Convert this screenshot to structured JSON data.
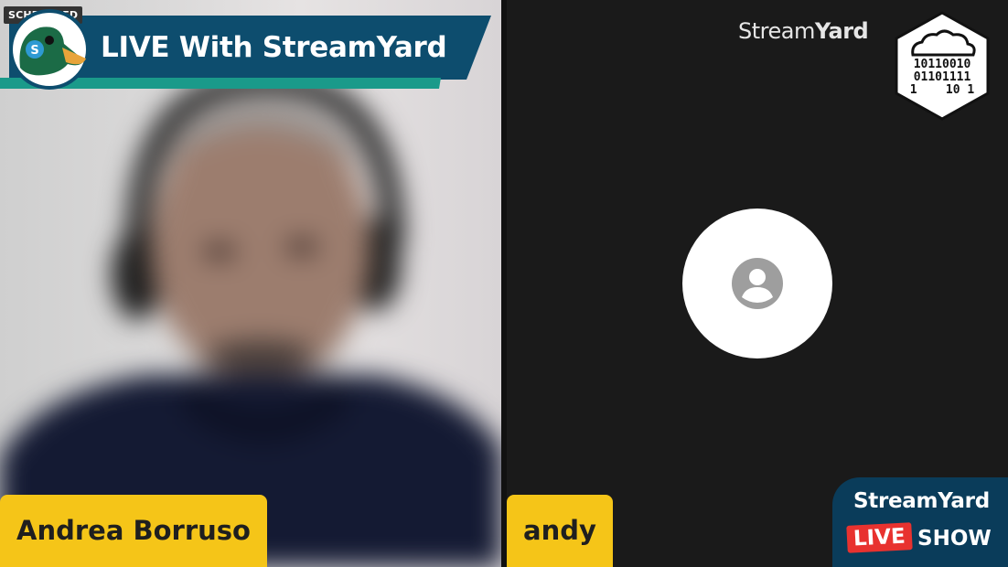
{
  "status_badge": "SCHEDULED",
  "banner": {
    "title": "LIVE With StreamYard"
  },
  "participants": [
    {
      "name": "Andrea Borruso",
      "video": "on"
    },
    {
      "name": "andy",
      "video": "off"
    }
  ],
  "brand_logo": {
    "text_light": "Stream",
    "text_bold": "Yard"
  },
  "hex_logo": {
    "icon": "cloud-binary-hex-icon",
    "rows": [
      "10110010",
      "01101111",
      "1    10 1"
    ]
  },
  "live_show_badge": {
    "title": "StreamYard",
    "live_label": "LIVE",
    "show_label": "SHOW"
  },
  "colors": {
    "nameplate": "#f5c518",
    "banner_blue": "#0d4d6e",
    "banner_green": "#1a9a8a",
    "live_red": "#e8322f",
    "badge_navy": "#0a3c5a"
  }
}
